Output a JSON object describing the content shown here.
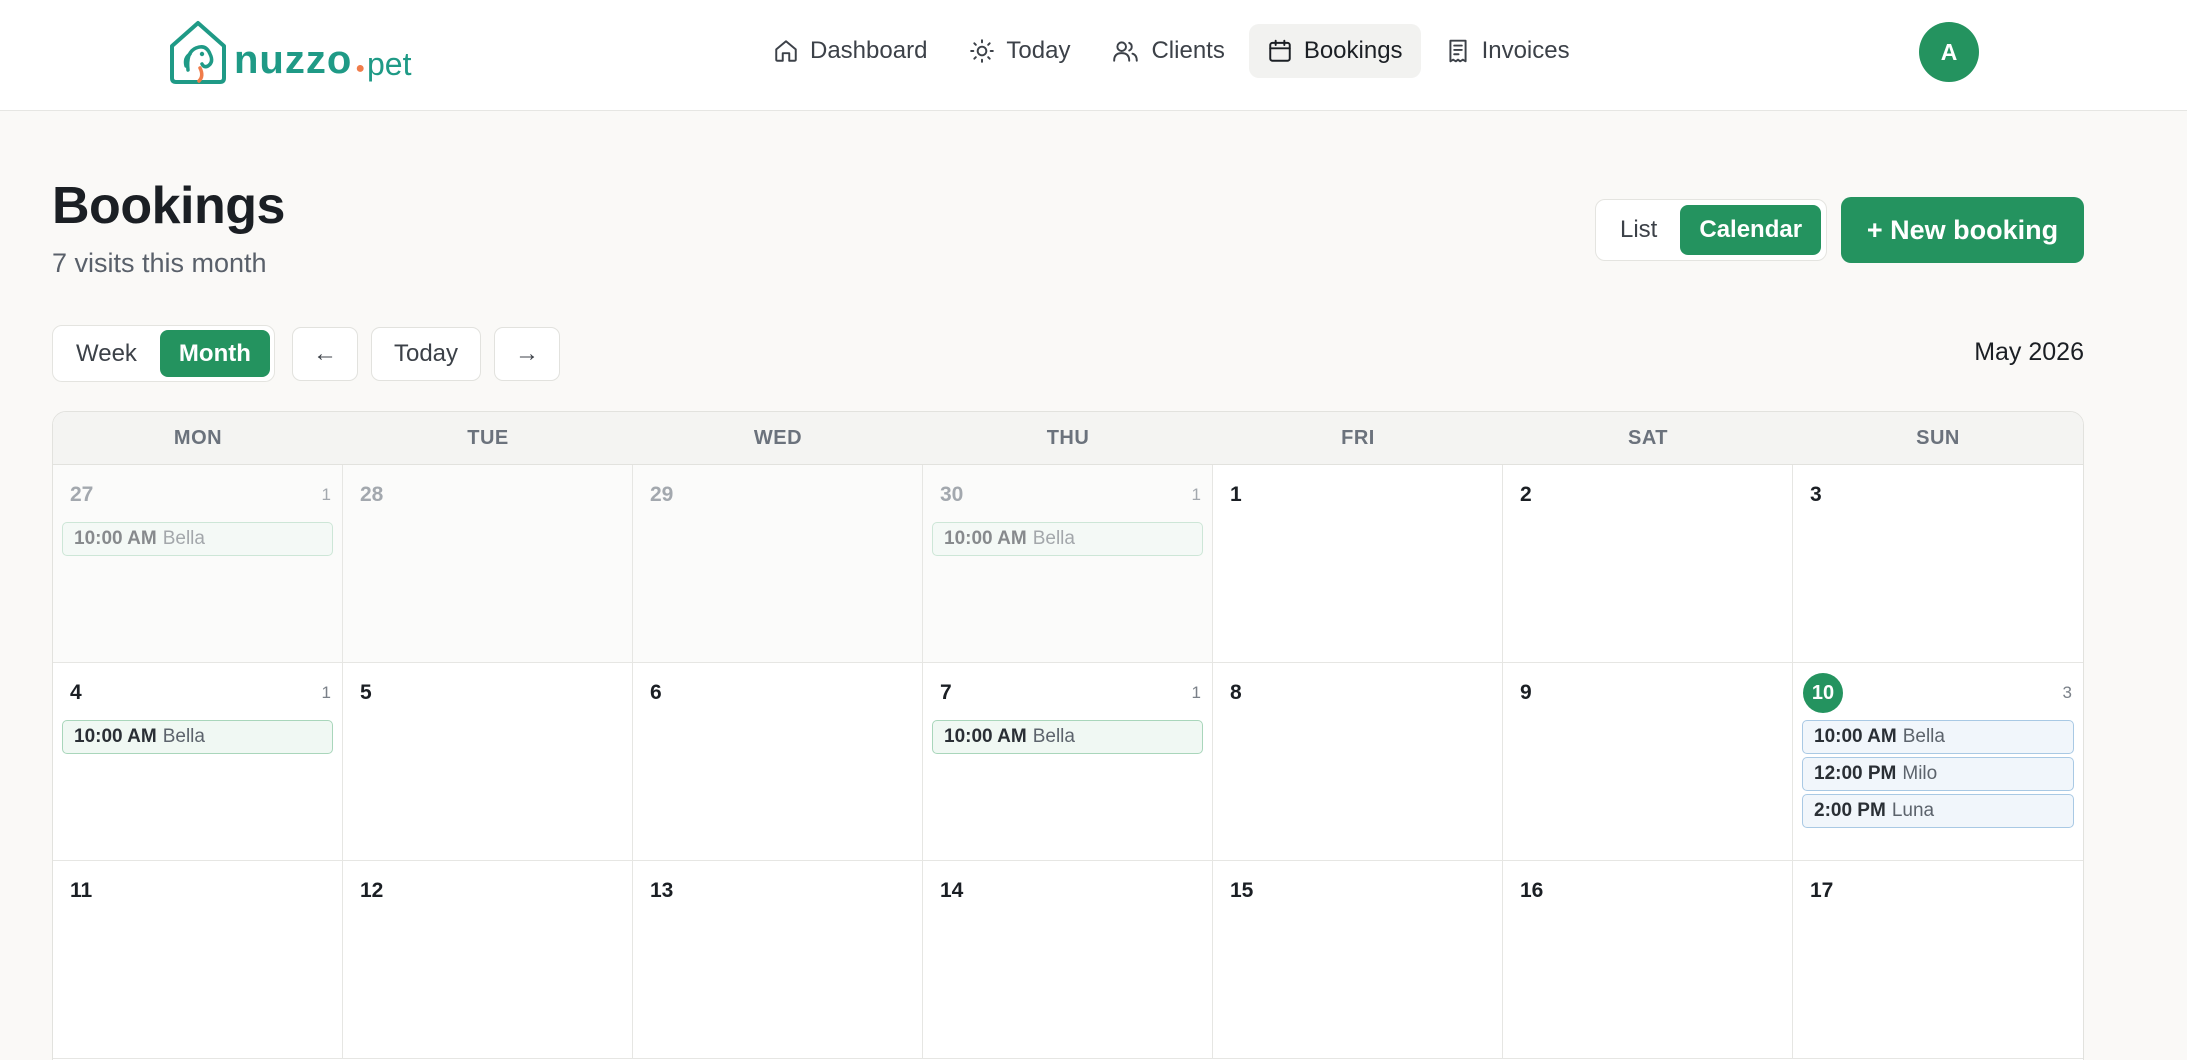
{
  "brand": {
    "word": "nuzzo",
    "suffix": "pet"
  },
  "nav": {
    "items": [
      {
        "label": "Dashboard",
        "icon": "home-icon",
        "active": false
      },
      {
        "label": "Today",
        "icon": "sun-icon",
        "active": false
      },
      {
        "label": "Clients",
        "icon": "users-icon",
        "active": false
      },
      {
        "label": "Bookings",
        "icon": "calendar-icon",
        "active": true
      },
      {
        "label": "Invoices",
        "icon": "receipt-icon",
        "active": false
      }
    ],
    "avatar_initial": "A"
  },
  "header": {
    "title": "Bookings",
    "subtitle": "7 visits this month",
    "view_toggle": {
      "list": "List",
      "calendar": "Calendar",
      "selected": "Calendar"
    },
    "new_booking": "+ New booking"
  },
  "controls": {
    "week": "Week",
    "month": "Month",
    "selected": "Month",
    "prev": "←",
    "today": "Today",
    "next": "→",
    "month_label": "May 2026"
  },
  "calendar": {
    "weekdays": [
      "MON",
      "TUE",
      "WED",
      "THU",
      "FRI",
      "SAT",
      "SUN"
    ],
    "today": "10",
    "days": [
      {
        "num": "27",
        "out": true,
        "count": "1",
        "events": [
          {
            "time": "10:00 AM",
            "name": "Bella",
            "color": "green"
          }
        ]
      },
      {
        "num": "28",
        "out": true,
        "count": "",
        "events": []
      },
      {
        "num": "29",
        "out": true,
        "count": "",
        "events": []
      },
      {
        "num": "30",
        "out": true,
        "count": "1",
        "events": [
          {
            "time": "10:00 AM",
            "name": "Bella",
            "color": "green"
          }
        ]
      },
      {
        "num": "1",
        "out": false,
        "count": "",
        "events": []
      },
      {
        "num": "2",
        "out": false,
        "count": "",
        "events": []
      },
      {
        "num": "3",
        "out": false,
        "count": "",
        "events": []
      },
      {
        "num": "4",
        "out": false,
        "count": "1",
        "events": [
          {
            "time": "10:00 AM",
            "name": "Bella",
            "color": "green"
          }
        ]
      },
      {
        "num": "5",
        "out": false,
        "count": "",
        "events": []
      },
      {
        "num": "6",
        "out": false,
        "count": "",
        "events": []
      },
      {
        "num": "7",
        "out": false,
        "count": "1",
        "events": [
          {
            "time": "10:00 AM",
            "name": "Bella",
            "color": "green"
          }
        ]
      },
      {
        "num": "8",
        "out": false,
        "count": "",
        "events": []
      },
      {
        "num": "9",
        "out": false,
        "count": "",
        "events": []
      },
      {
        "num": "10",
        "out": false,
        "count": "3",
        "events": [
          {
            "time": "10:00 AM",
            "name": "Bella",
            "color": "blue"
          },
          {
            "time": "12:00 PM",
            "name": "Milo",
            "color": "blue"
          },
          {
            "time": "2:00 PM",
            "name": "Luna",
            "color": "blue"
          }
        ]
      },
      {
        "num": "11",
        "out": false,
        "count": "",
        "events": []
      },
      {
        "num": "12",
        "out": false,
        "count": "",
        "events": []
      },
      {
        "num": "13",
        "out": false,
        "count": "",
        "events": []
      },
      {
        "num": "14",
        "out": false,
        "count": "",
        "events": []
      },
      {
        "num": "15",
        "out": false,
        "count": "",
        "events": []
      },
      {
        "num": "16",
        "out": false,
        "count": "",
        "events": []
      },
      {
        "num": "17",
        "out": false,
        "count": "",
        "events": []
      }
    ]
  },
  "colors": {
    "accent": "#24935f",
    "brand": "#1f9a86",
    "paw": "#f07c4a"
  }
}
